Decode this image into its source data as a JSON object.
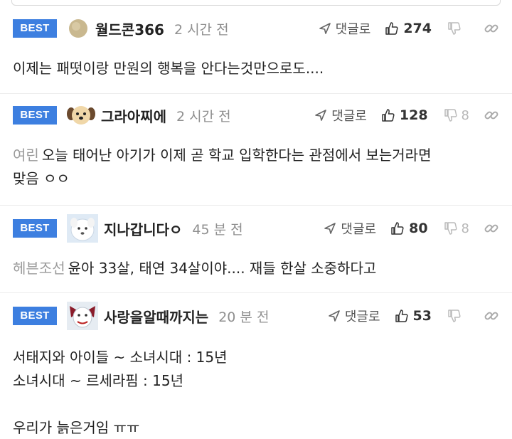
{
  "labels": {
    "best": "BEST",
    "reply": "댓글로"
  },
  "colors": {
    "best_badge": "#3d7fe0",
    "muted": "#8f8f8f",
    "dislike": "#b8b8b8"
  },
  "comments": [
    {
      "nickname": "월드콘366",
      "time": "2 시간 전",
      "likes": "274",
      "dislikes": "",
      "mention": "",
      "lines": [
        "이제는 패떳이랑 만원의 행복을 안다는것만으로도...."
      ],
      "avatar": "tan-circle-avatar"
    },
    {
      "nickname": "그라아찌에",
      "time": "2 시간 전",
      "likes": "128",
      "dislikes": "8",
      "mention": "여린",
      "lines": [
        "오늘 태어난 아기가 이제 곧 학교 입학한다는 관점에서 보는거라면",
        "맞음 ㅇㅇ"
      ],
      "avatar": "puppy-avatar"
    },
    {
      "nickname": "지나갑니다ㅇ",
      "time": "45 분 전",
      "likes": "80",
      "dislikes": "8",
      "mention": "헤븐조선",
      "lines": [
        "윤아 33살, 태연 34살이야.... 재들 한살 소중하다고"
      ],
      "avatar": "white-dog-avatar"
    },
    {
      "nickname": "사랑을알때까지는",
      "time": "20 분 전",
      "likes": "53",
      "dislikes": "",
      "mention": "",
      "lines": [
        "서태지와 아이들 ~ 소녀시대 : 15년",
        "소녀시대 ~ 르세라핌 : 15년",
        "",
        "우리가 늙은거임 ㅠㅠ"
      ],
      "avatar": "clown-avatar"
    }
  ]
}
